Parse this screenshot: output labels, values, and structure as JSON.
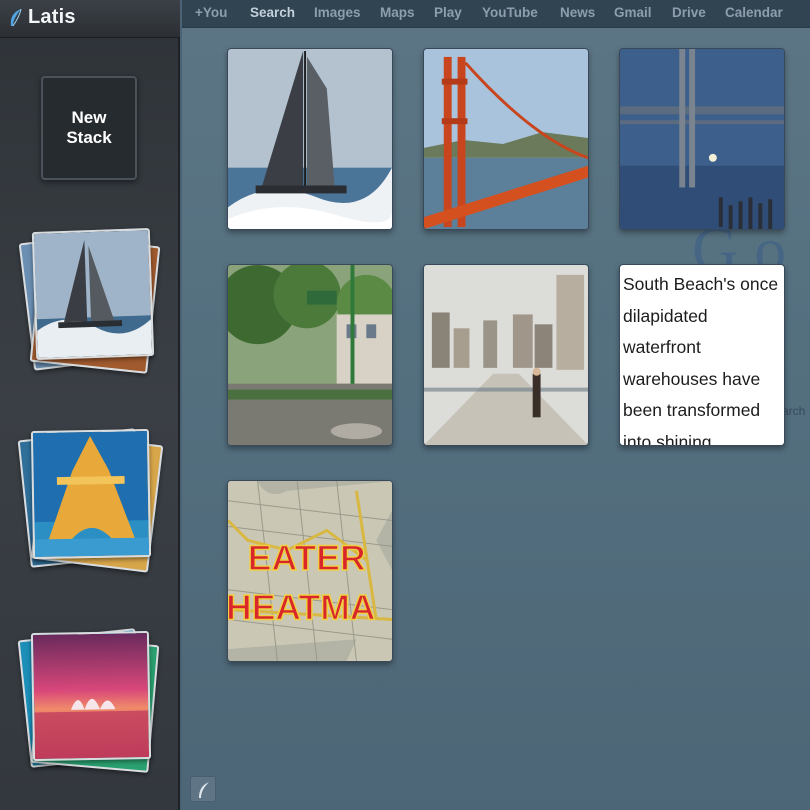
{
  "app": {
    "title": "Latis",
    "logo_icon": "feather-logo-icon",
    "accent_color": "#4fa3e0"
  },
  "sidebar": {
    "new_stack_label_line1": "New",
    "new_stack_label_line2": "Stack",
    "stacks": [
      {
        "name": "sailboat-stack",
        "cover_icon": "sailboat-photo"
      },
      {
        "name": "eiffel-tower-stack",
        "cover_icon": "eiffel-tower-photo"
      },
      {
        "name": "sydney-opera-stack",
        "cover_icon": "sunset-opera-house-photo"
      }
    ],
    "footer_icon": "feather-icon"
  },
  "nav": {
    "items": [
      "+You",
      "Search",
      "Images",
      "Maps",
      "Play",
      "YouTube",
      "News",
      "Gmail",
      "Drive",
      "Calendar"
    ],
    "active": "Search"
  },
  "main": {
    "tiles": [
      {
        "name": "sailboat-tile",
        "icon": "sailboat-photo"
      },
      {
        "name": "golden-gate-tile",
        "icon": "golden-gate-bridge-photo"
      },
      {
        "name": "bay-bridge-tile",
        "icon": "bay-bridge-night-photo"
      },
      {
        "name": "street-park-tile",
        "icon": "city-park-photo"
      },
      {
        "name": "waterfront-tile",
        "icon": "pier-skyline-photo"
      },
      {
        "name": "south-beach-text-tile",
        "text": "South Beach's once dilapidated waterfront warehouses have been transformed into shining"
      },
      {
        "name": "eater-heatmap-tile",
        "icon": "map-photo",
        "line1": "EATER",
        "line2": "HEATMA"
      }
    ],
    "background_text": {
      "logo_fragment": "G o",
      "search_fragment": "arch"
    }
  }
}
